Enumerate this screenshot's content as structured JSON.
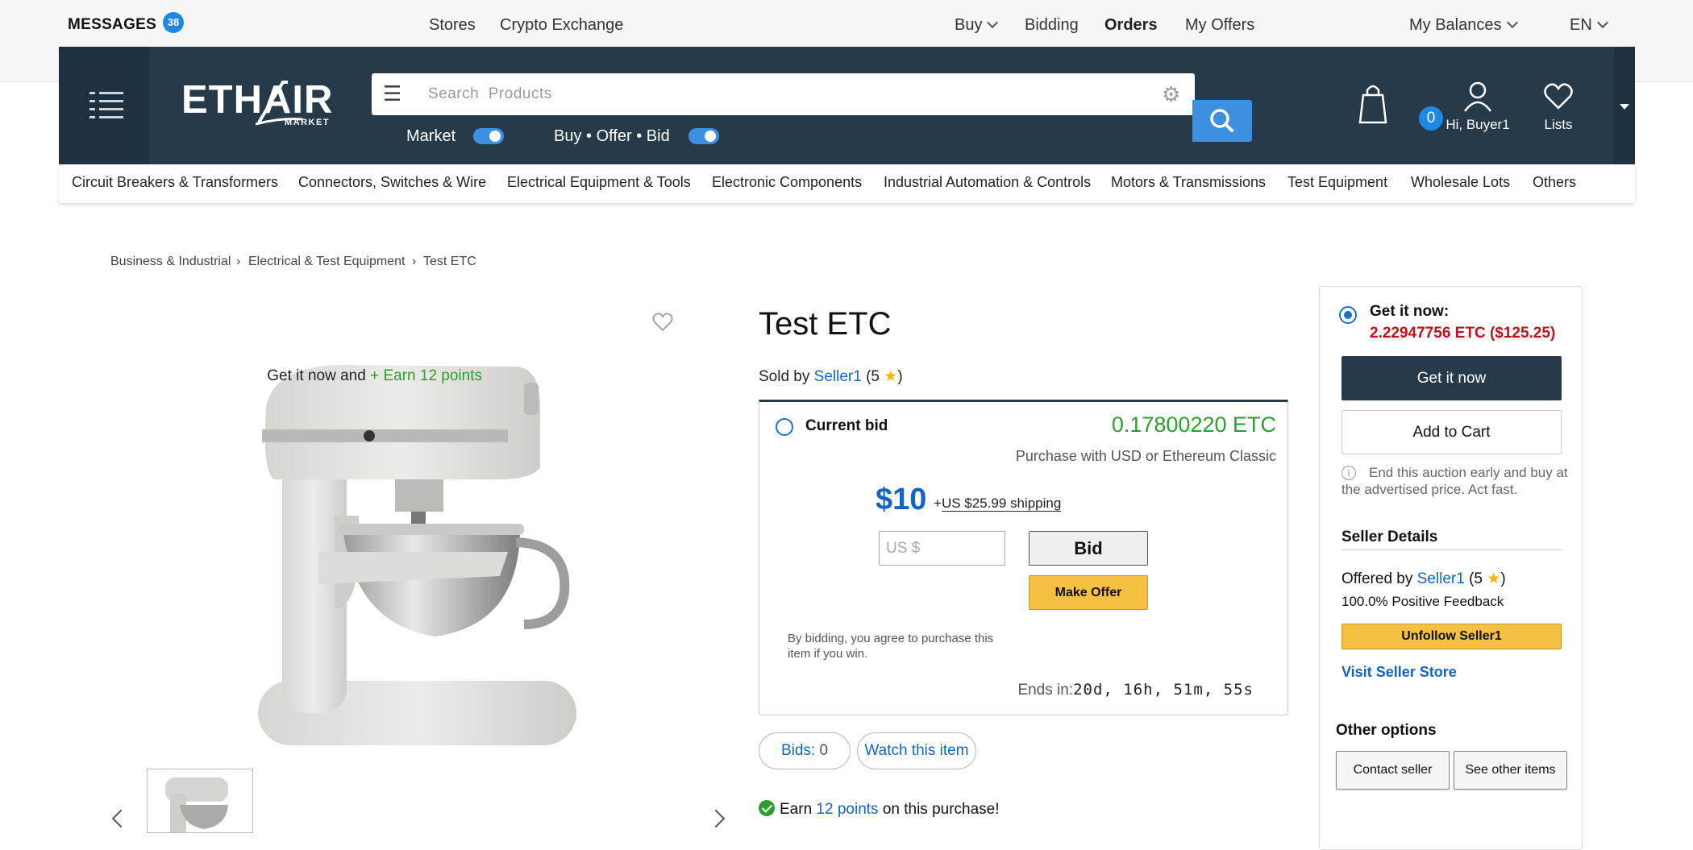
{
  "topbar": {
    "messages_label": "MESSAGES",
    "messages_count": "38",
    "stores": "Stores",
    "crypto": "Crypto Exchange",
    "buy": "Buy",
    "bidding": "Bidding",
    "orders": "Orders",
    "my_offers": "My Offers",
    "my_balances": "My Balances",
    "language": "EN"
  },
  "header": {
    "logo_main": "ETHAIR",
    "logo_sub": "MARKET",
    "search_placeholder": "Search  Products",
    "toggle_market": "Market",
    "toggle_buy": "Buy • Offer • Bid",
    "cart_count": "0",
    "account_label": "Hi, Buyer1",
    "lists_label": "Lists",
    "icons": [
      "hamburger-icon",
      "menu-icon",
      "gear-icon",
      "search-icon",
      "shopping-bag-icon",
      "user-icon",
      "heart-icon",
      "caret-down-icon"
    ]
  },
  "categories": [
    "Circuit Breakers & Transformers",
    "Connectors, Switches & Wire",
    "Electrical Equipment & Tools",
    "Electronic Components",
    "Industrial Automation & Controls",
    "Motors & Transmissions",
    "Test Equipment",
    "Wholesale Lots",
    "Others"
  ],
  "breadcrumb": [
    "Business & Industrial",
    "Electrical & Test Equipment",
    "Test ETC"
  ],
  "breadcrumb_sep": "›",
  "product": {
    "title": "Test ETC",
    "sold_by_prefix": "Sold by",
    "seller": "Seller1",
    "seller_rating": "5",
    "getit_prefix": "Get it now and",
    "earn_points": "+ Earn 12 points"
  },
  "bid": {
    "label": "Current bid",
    "etc_value": "0.17800220 ETC",
    "purchase_with": "Purchase with USD or Ethereum Classic",
    "price": "$10",
    "shipping_prefix": "+",
    "shipping": "US $25.99 shipping",
    "input_placeholder": "US $",
    "bid_button": "Bid",
    "offer_button": "Make Offer",
    "agree": "By bidding, you agree to purchase this item if you win.",
    "ends_label": "Ends in:",
    "ends_value": "20d, 16h, 51m, 55s"
  },
  "pills": {
    "bids_label": "Bids:",
    "bids_count": "0",
    "watch": "Watch this item"
  },
  "earn_purchase": {
    "prefix": "Earn",
    "points": "12 points",
    "suffix": "on this purchase!"
  },
  "panel": {
    "getit_label": "Get it now:",
    "getit_price": "2.22947756 ETC ($125.25)",
    "getit_button": "Get it now",
    "cart_button": "Add to Cart",
    "end_early": "End this auction early and buy at the advertised price. Act fast.",
    "seller_details": "Seller Details",
    "offered_prefix": "Offered by",
    "seller": "Seller1",
    "seller_rating": "5",
    "positive": "100.0% Positive Feedback",
    "unfollow": "Unfollow Seller1",
    "visit": "Visit Seller Store",
    "other_options": "Other options",
    "contact": "Contact seller",
    "see_other": "See other items"
  },
  "colors": {
    "header_bg": "#263a4a",
    "accent_blue": "#3d8fe0",
    "link_blue": "#1565c0",
    "green": "#2e9e2e",
    "price_red": "#c0101a",
    "offer_yellow": "#f6c042"
  }
}
